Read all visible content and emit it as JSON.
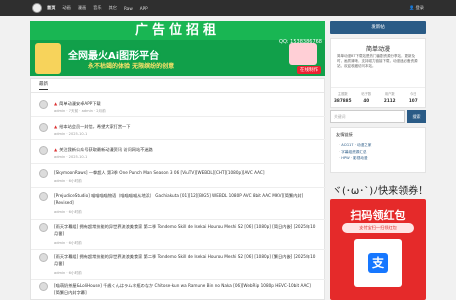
{
  "topbar": {
    "nav": [
      "首页",
      "动画",
      "漫画",
      "音乐",
      "其它",
      "Raw",
      "APP"
    ],
    "active_index": 0,
    "login": "登录"
  },
  "banner": {
    "headline": "广告位招租",
    "qq": "QQ: 1538386768",
    "line1": "全网最火Ai图形平台",
    "line2": "永不枯竭的体验 无限缤纷的创意",
    "badge": "在线制作"
  },
  "main": {
    "tab": "最新",
    "topics": [
      {
        "title": "简单动漫安卓APP下载",
        "pinned": true,
        "meta": "admin · 7天前 · admin · 2月前"
      },
      {
        "title": "给本站会员一封信，希望大家打赏一下",
        "pinned": true,
        "meta": "admin · 2025-10-1"
      },
      {
        "title": "关注我新公众号获取最新动漫资讯 访问网站不迷路",
        "pinned": true,
        "meta": "admin · 2025-10-1"
      },
      {
        "title": "[SkymoonRaws] 一拳超人 第3季 One Punch Man Season 3 06 [ViuTV][WEBDL][CHT][1080p][AVC AAC]",
        "pinned": false,
        "meta": "admin · 6小时前"
      },
      {
        "title": "[PrejudiceStudio] 喵喵喵喵物语（喵喵喵喵从地浜） Gachiakuta [01][12][BIG5] WEBDL 1080P AVC 8bit AAC MKV][简繁内封][Revised]",
        "pinned": false,
        "meta": "admin · 6小时前"
      },
      {
        "title": "[雨天字幕组] 拥有超常技能的异世界流浪美食家 第二季 Tondemo Skill de Isekai Hourou Meshi S2 [06] [1080p] [简日内嵌] [2025年10月番]",
        "pinned": false,
        "meta": "admin · 6小时前"
      },
      {
        "title": "[雨天字幕组] 拥有超常技能的异世界流浪美食家 第二季 Tondemo Skill de Isekai Hourou Meshi S2 [06] [1080p] [繁日内嵌] [2025年10月番]",
        "pinned": false,
        "meta": "admin · 6小时前"
      },
      {
        "title": "[喵萌奶茶屋&LoliHouse] 千歳くんはラムネ瓶のなか Chitose-kun wa Ramune Bin no Naka [06][WebRip 1080p HEVC-10bit AAC][简繁日内封字幕]",
        "pinned": false,
        "meta": ""
      }
    ]
  },
  "sidebar": {
    "new_post": "发新帖",
    "site_title": "简单动漫",
    "site_desc": "简单动漫BT下载站是热门番剧资源分享站，更新及时，画质清晰，支持磁力链接下载，动漫迷必备资源站，欢迎收藏访问本站。",
    "stats": [
      {
        "label": "主题数",
        "value": "387885"
      },
      {
        "label": "帖子数",
        "value": "40"
      },
      {
        "label": "用户数",
        "value": "2112"
      },
      {
        "label": "今日",
        "value": "107"
      }
    ],
    "search_placeholder": "关键词",
    "search_button": "搜索",
    "links_title": "友情链接",
    "links": [
      "ACG17 · 动漫之家",
      "字幕组资源汇总",
      "HPW · 影视动漫"
    ],
    "promo_text": "ヾ(･ω･`)ﾉ快来领券！",
    "promo_head": "扫码领红包",
    "promo_sub": "支付宝扫一扫领红包"
  },
  "colors": {
    "topbar": "#2f2f2f",
    "accent": "#2a5b86",
    "banner_green": "#11a04a",
    "promo_red": "#e52a2a"
  }
}
